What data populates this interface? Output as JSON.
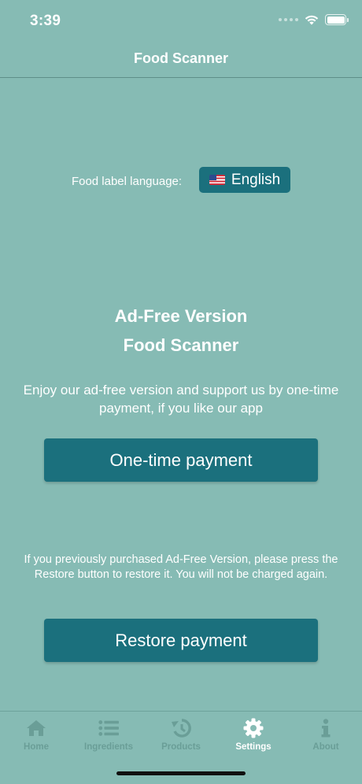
{
  "status_bar": {
    "time": "3:39"
  },
  "nav": {
    "title": "Food Scanner"
  },
  "language": {
    "label": "Food label language:",
    "button_label": "English",
    "flag_icon": "us-flag-icon"
  },
  "ad_free": {
    "title_line1": "Ad-Free Version",
    "title_line2": "Food Scanner",
    "description": "Enjoy our ad-free version and support us by one-time payment, if you like our app",
    "pay_button": "One-time payment",
    "restore_info": "If you previously purchased Ad-Free Version, please press the Restore button to restore it. You will not be charged again.",
    "restore_button": "Restore payment"
  },
  "tabs": [
    {
      "label": "Home",
      "icon": "home-icon",
      "active": false
    },
    {
      "label": "Ingredients",
      "icon": "list-icon",
      "active": false
    },
    {
      "label": "Products",
      "icon": "history-icon",
      "active": false
    },
    {
      "label": "Settings",
      "icon": "gear-icon",
      "active": true
    },
    {
      "label": "About",
      "icon": "info-icon",
      "active": false
    }
  ],
  "colors": {
    "background": "#86bbb4",
    "button": "#1b707d",
    "tab_inactive": "#6a9e97",
    "tab_active": "#ffffff"
  }
}
